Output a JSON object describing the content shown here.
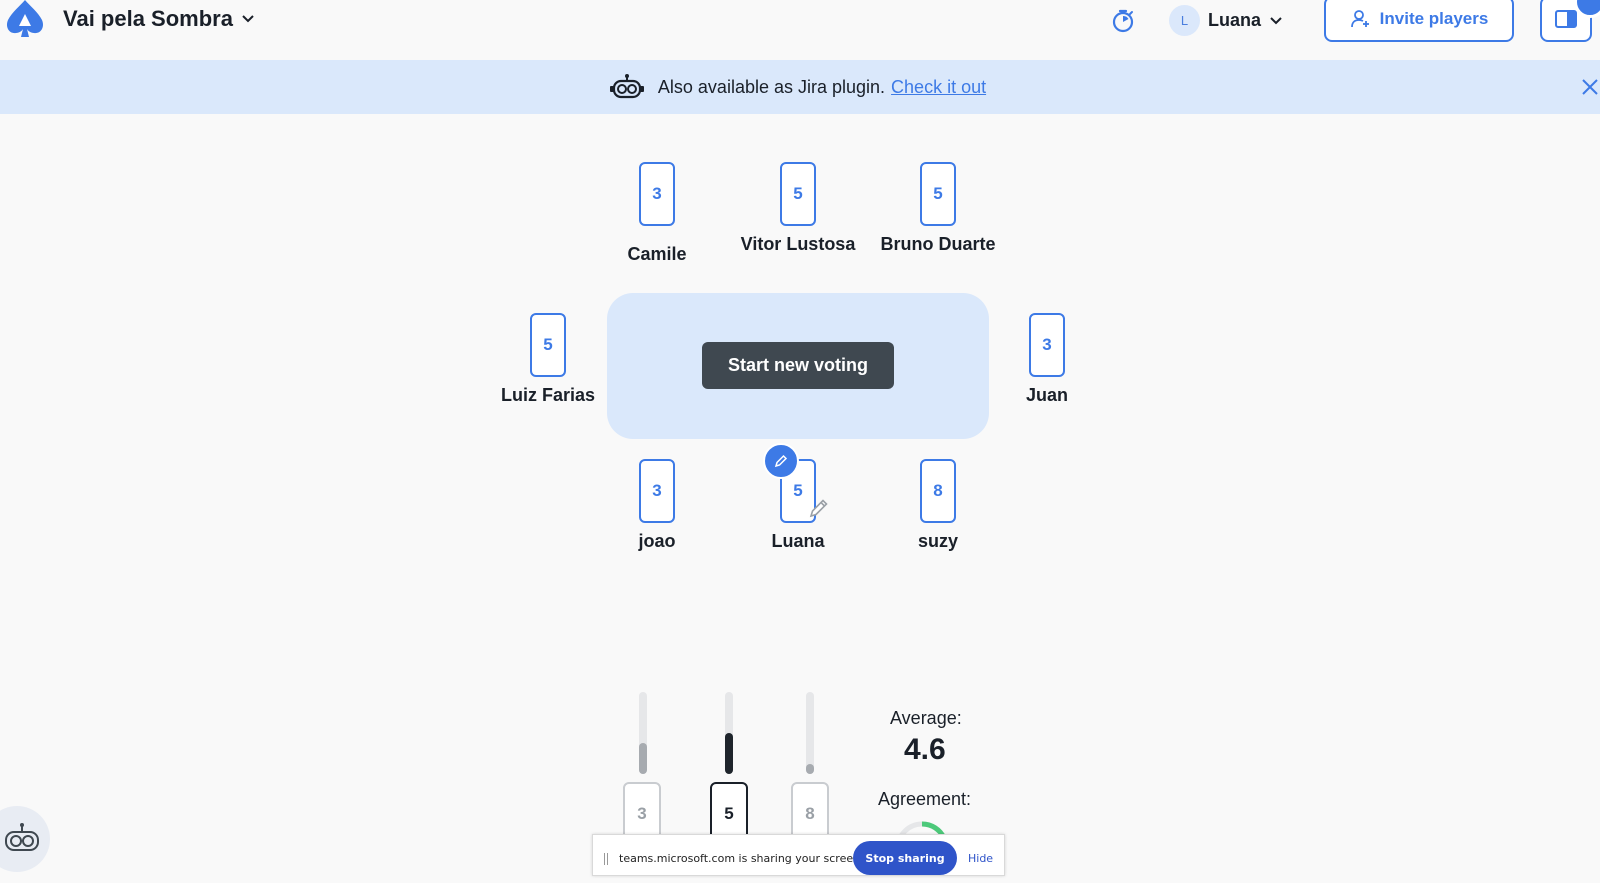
{
  "header": {
    "room_title": "Vai pela Sombra",
    "user_initial": "L",
    "user_name": "Luana",
    "invite_label": "Invite players"
  },
  "banner": {
    "text": "Also available as Jira plugin.",
    "link": "Check it out"
  },
  "players": [
    {
      "name": "Camile",
      "vote": "3"
    },
    {
      "name": "Vitor Lustosa",
      "vote": "5"
    },
    {
      "name": "Bruno Duarte",
      "vote": "5"
    },
    {
      "name": "Luiz Farias",
      "vote": "5"
    },
    {
      "name": "Juan",
      "vote": "3"
    },
    {
      "name": "joao",
      "vote": "3"
    },
    {
      "name": "Luana",
      "vote": "5"
    },
    {
      "name": "suzy",
      "vote": "8"
    }
  ],
  "table": {
    "start_label": "Start new voting"
  },
  "results": {
    "distribution": [
      {
        "card": "3",
        "votes": 3,
        "selected": false
      },
      {
        "card": "5",
        "votes": 4,
        "selected": true
      },
      {
        "card": "8",
        "votes": 1,
        "selected": false
      }
    ],
    "average_label": "Average:",
    "average_value": "4.6",
    "agreement_label": "Agreement:"
  },
  "share_bar": {
    "text": "teams.microsoft.com is sharing your screen.",
    "stop_label": "Stop sharing",
    "hide_label": "Hide"
  },
  "colors": {
    "accent": "#3d7ae6",
    "banner_bg": "#dae8fb",
    "button_dark": "#3f4850",
    "agreement_green": "#4cc97a"
  }
}
